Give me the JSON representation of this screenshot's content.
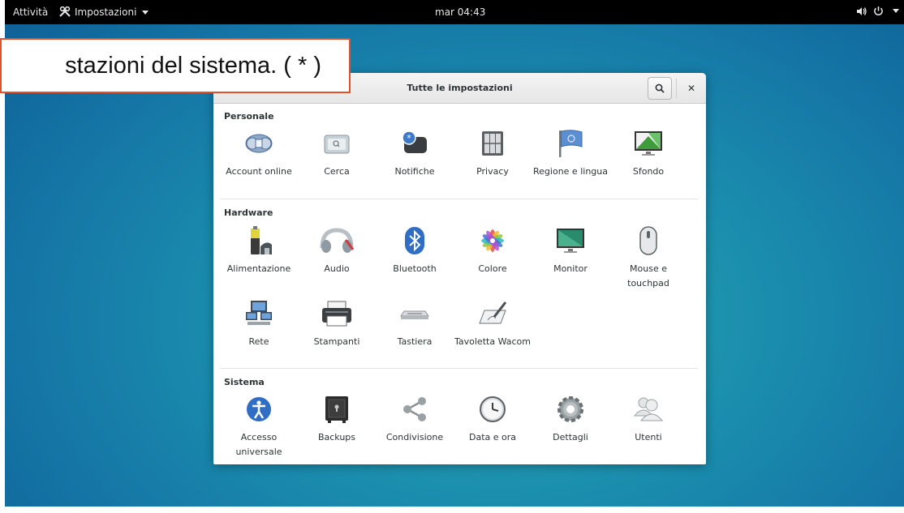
{
  "topbar": {
    "activities": "Attività",
    "app_menu": "Impostazioni",
    "clock": "mar 04:43"
  },
  "callout": {
    "text": "stazioni del sistema. ( * )"
  },
  "window": {
    "title": "Tutte le impostazioni"
  },
  "sections": {
    "personale": {
      "title": "Personale",
      "items": [
        {
          "label": "Account online",
          "icon": "online-accounts-icon"
        },
        {
          "label": "Cerca",
          "icon": "search-settings-icon"
        },
        {
          "label": "Notifiche",
          "icon": "notifications-icon"
        },
        {
          "label": "Privacy",
          "icon": "privacy-icon"
        },
        {
          "label": "Regione e lingua",
          "icon": "region-flag-icon"
        },
        {
          "label": "Sfondo",
          "icon": "background-icon"
        }
      ]
    },
    "hardware": {
      "title": "Hardware",
      "items": [
        {
          "label": "Alimentazione",
          "icon": "power-battery-icon"
        },
        {
          "label": "Audio",
          "icon": "audio-icon"
        },
        {
          "label": "Bluetooth",
          "icon": "bluetooth-icon"
        },
        {
          "label": "Colore",
          "icon": "color-icon"
        },
        {
          "label": "Monitor",
          "icon": "monitor-icon"
        },
        {
          "label": "Mouse e touchpad",
          "icon": "mouse-icon"
        },
        {
          "label": "Rete",
          "icon": "network-icon"
        },
        {
          "label": "Stampanti",
          "icon": "printer-icon"
        },
        {
          "label": "Tastiera",
          "icon": "keyboard-icon"
        },
        {
          "label": "Tavoletta Wacom",
          "icon": "wacom-tablet-icon"
        }
      ]
    },
    "sistema": {
      "title": "Sistema",
      "items": [
        {
          "label": "Accesso universale",
          "icon": "universal-access-icon"
        },
        {
          "label": "Backups",
          "icon": "backups-safe-icon"
        },
        {
          "label": "Condivisione",
          "icon": "sharing-icon"
        },
        {
          "label": "Data e ora",
          "icon": "clock-icon"
        },
        {
          "label": "Dettagli",
          "icon": "gear-details-icon"
        },
        {
          "label": "Utenti",
          "icon": "users-icon"
        }
      ]
    }
  }
}
